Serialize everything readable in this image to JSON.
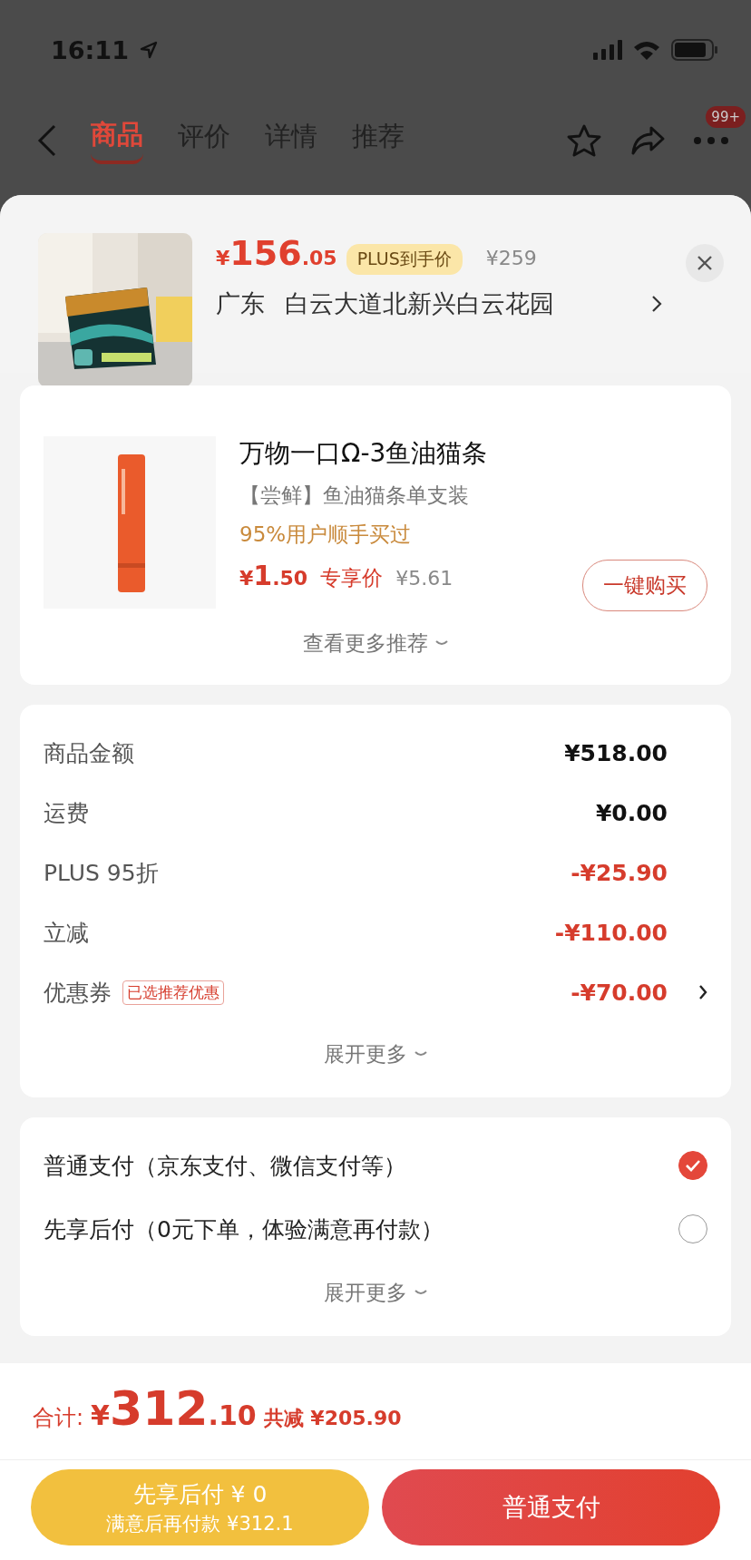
{
  "status_bar": {
    "time": "16:11"
  },
  "nav": {
    "tabs": [
      {
        "label": "商品",
        "selected": true
      },
      {
        "label": "评价",
        "selected": false
      },
      {
        "label": "详情",
        "selected": false
      },
      {
        "label": "推荐",
        "selected": false
      }
    ],
    "badge": "99+"
  },
  "header": {
    "currency": "¥",
    "price_int": "156",
    "price_dec": ".05",
    "tag": "PLUS到手价",
    "original": "¥259",
    "region": "广东",
    "address": "白云大道北新兴白云花园"
  },
  "recommend": {
    "title": "万物一口Ω-3鱼油猫条",
    "subtitle": "【尝鲜】鱼油猫条单支装",
    "promo": "95%用户顺手买过",
    "currency": "¥",
    "price_int": "1",
    "price_dec": ".50",
    "price_label": "专享价",
    "original": "¥5.61",
    "button": "一键购买",
    "more": "查看更多推荐"
  },
  "summary": {
    "rows": [
      {
        "label": "商品金额",
        "value": "¥518.00",
        "kind": "normal",
        "arrow": false
      },
      {
        "label": "运费",
        "value": "¥0.00",
        "kind": "normal",
        "arrow": false
      },
      {
        "label": "PLUS 95折",
        "value": "-¥25.90",
        "kind": "discount",
        "arrow": false
      },
      {
        "label": "立减",
        "value": "-¥110.00",
        "kind": "discount",
        "arrow": false
      },
      {
        "label": "优惠券",
        "tag": "已选推荐优惠",
        "value": "-¥70.00",
        "kind": "discount",
        "arrow": true
      }
    ],
    "more": "展开更多"
  },
  "payment": {
    "options": [
      {
        "label": "普通支付（京东支付、微信支付等）",
        "selected": true
      },
      {
        "label": "先享后付（0元下单，体验满意再付款）",
        "selected": false
      }
    ],
    "more": "展开更多"
  },
  "footer": {
    "total_label": "合计:",
    "currency": "¥",
    "total_int": "312",
    "total_dec": ".10",
    "saved": "共减 ¥205.90",
    "later_title": "先享后付 ¥ 0",
    "later_sub": "满意后再付款 ¥312.1",
    "pay": "普通支付"
  }
}
